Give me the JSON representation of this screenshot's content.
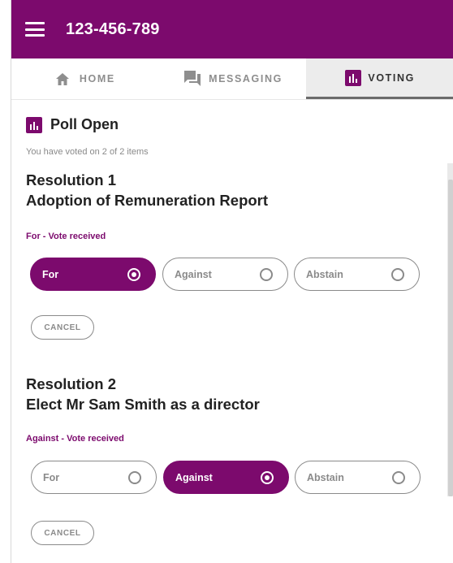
{
  "header": {
    "title": "123-456-789",
    "menu_icon": "hamburger-icon",
    "background": "#7c0a6d"
  },
  "tabs": [
    {
      "label": "HOME",
      "icon": "home-icon",
      "active": false
    },
    {
      "label": "MESSAGING",
      "icon": "chat-icon",
      "active": false
    },
    {
      "label": "VOTING",
      "icon": "poll-icon",
      "active": true
    }
  ],
  "poll": {
    "title": "Poll Open",
    "icon": "poll-icon",
    "summary": "You have voted on 2 of 2 items"
  },
  "resolutions": [
    {
      "number": "Resolution 1",
      "name": "Adoption of Remuneration Report",
      "status": "For - Vote received",
      "options": [
        {
          "label": "For",
          "selected": true
        },
        {
          "label": "Against",
          "selected": false
        },
        {
          "label": "Abstain",
          "selected": false
        }
      ],
      "cancel_label": "CANCEL"
    },
    {
      "number": "Resolution 2",
      "name": "Elect Mr Sam Smith as a director",
      "status": "Against - Vote received",
      "options": [
        {
          "label": "For",
          "selected": false
        },
        {
          "label": "Against",
          "selected": true
        },
        {
          "label": "Abstain",
          "selected": false
        }
      ],
      "cancel_label": "CANCEL"
    }
  ],
  "colors": {
    "accent": "#7c0a6d",
    "muted": "#8a8a8a"
  }
}
